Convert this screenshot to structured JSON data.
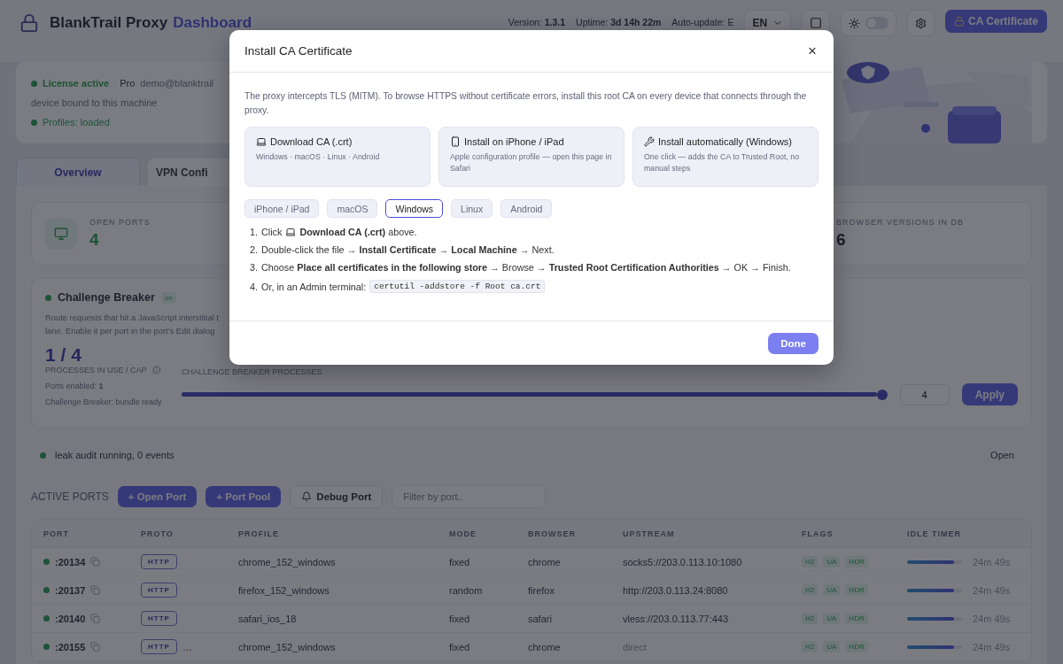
{
  "header": {
    "brand": "BlankTrail Proxy",
    "subtitle": "Dashboard",
    "version": "Version: **1.3.1**",
    "uptime": "Uptime: **3d 14h 22m**",
    "autoupdate": "Auto-update: E",
    "language": "EN",
    "dark_mode": false,
    "ca_button": "CA Certificate"
  },
  "license": {
    "status": "License active",
    "plan": "Pro",
    "email": "demo@blanktrail",
    "device": "device bound to this machine",
    "profiles": "Profiles: loaded"
  },
  "tabs": [
    {
      "label": "Overview",
      "selected": true
    },
    {
      "label": "VPN Confi",
      "selected": false
    }
  ],
  "stats": [
    {
      "label": "OPEN PORTS",
      "value": "4",
      "kind": "icon"
    },
    {
      "label": "BROWSER VERSIONS IN DB",
      "value": "6",
      "kind": "plain"
    }
  ],
  "challenge": {
    "title": "Challenge Breaker",
    "badge": "on",
    "description": [
      "Route requests that hit a JavaScript interstitial t",
      "lane. Enable it per port in the port's Edit dialog"
    ],
    "usage": "1 / 4",
    "usage_label": "PROCESSES IN USE / CAP",
    "ports_enabled": "Ports enabled: **1**",
    "bundle": "Challenge Breaker: bundle ready",
    "slider_label": "CHALLENGE BREAKER PROCESSES",
    "level": 1,
    "input": "4",
    "apply": "Apply"
  },
  "leak": {
    "text": "leak audit running, 0 events",
    "open": "Open"
  },
  "ports": {
    "title": "ACTIVE PORTS",
    "buttons": [
      "+ Open Port",
      "+ Port Pool"
    ],
    "debug": "Debug Port",
    "filter_placeholder": "Filter by port..",
    "columns": [
      "PORT",
      "PROTO",
      "PROFILE",
      "MODE",
      "BROWSER",
      "UPSTREAM",
      "FLAGS",
      "IDLE TIMER"
    ],
    "rows": [
      {
        "port": ":20134",
        "proto": "HTTP",
        "profile": "chrome_152_windows",
        "mode": "fixed",
        "browser": "chrome",
        "upstream": "socks5://203.0.113.10:1080",
        "direct": false,
        "flags": [
          "H2",
          "UA",
          "HDR"
        ],
        "level": 0.85,
        "timer": "24m 49s"
      },
      {
        "port": ":20137",
        "proto": "HTTP",
        "profile": "firefox_152_windows",
        "mode": "random",
        "browser": "firefox",
        "upstream": "http://203.0.113.24:8080",
        "direct": false,
        "flags": [
          "H2",
          "UA",
          "HDR"
        ],
        "level": 0.85,
        "timer": "24m 49s"
      },
      {
        "port": ":20140",
        "proto": "HTTP",
        "profile": "safari_ios_18",
        "mode": "fixed",
        "browser": "safari",
        "upstream": "vless://203.0.113.77:443",
        "direct": false,
        "flags": [
          "H2",
          "UA",
          "HDR"
        ],
        "level": 0.85,
        "timer": "24m 49s"
      },
      {
        "port": ":20155",
        "proto": "HTTP",
        "extra": "…",
        "profile": "chrome_152_windows",
        "mode": "fixed",
        "browser": "chrome",
        "upstream": "direct",
        "direct": true,
        "flags": [
          "H2",
          "UA",
          "HDR"
        ],
        "level": 0.85,
        "timer": "24m 49s"
      }
    ]
  },
  "modal": {
    "title": "Install CA Certificate",
    "close": "×",
    "intro": "The proxy intercepts TLS (MITM). To browse HTTPS without certificate errors, install this root CA on every device that connects through the proxy.",
    "options": [
      {
        "kind": "laptop",
        "title": "Download CA (.crt)",
        "description": "Windows · macOS · Linux · Android"
      },
      {
        "kind": "phone",
        "title": "Install on iPhone / iPad",
        "description": "Apple configuration profile — open this page in Safari"
      },
      {
        "kind": "tools",
        "title": "Install automatically (Windows)",
        "description": "One click — adds the CA to Trusted Root, no manual steps"
      }
    ],
    "platforms": [
      {
        "label": "iPhone / iPad",
        "selected": false
      },
      {
        "label": "macOS",
        "selected": false
      },
      {
        "label": "Windows",
        "selected": true
      },
      {
        "label": "Linux",
        "selected": false
      },
      {
        "label": "Android",
        "selected": false
      }
    ],
    "steps": [
      {
        "kind": "icon",
        "number": "1.",
        "before": "Click",
        "text": "**Download CA (.crt)** above."
      },
      {
        "kind": "text",
        "number": "2.",
        "text": "Double-click the file → **Install Certificate** → **Local Machine** → Next."
      },
      {
        "kind": "text",
        "number": "3.",
        "text": "Choose **Place all certificates in the following store** → Browse → **Trusted Root Certification Authorities** → OK → Finish."
      },
      {
        "kind": "code",
        "number": "4.",
        "text": "Or, in an Admin terminal:",
        "code": "certutil -addstore -f Root ca.crt"
      }
    ],
    "done": "Done"
  }
}
